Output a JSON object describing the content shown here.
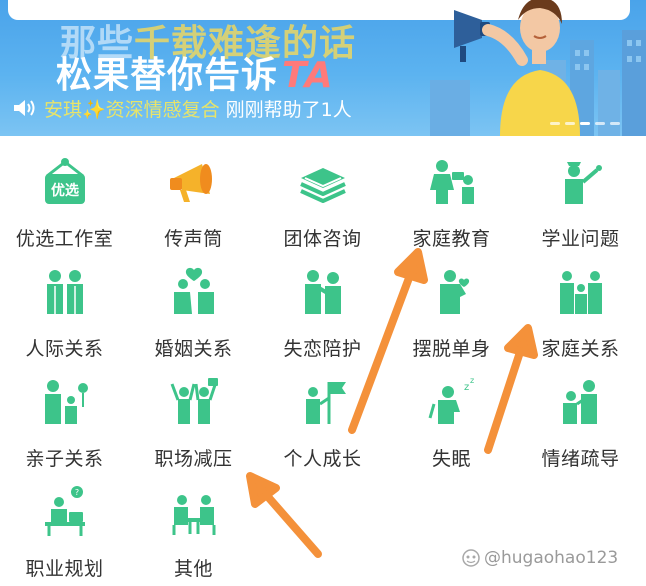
{
  "banner": {
    "headline1_pre": "那些",
    "headline1_hl": "千载难逢的话",
    "headline2": "松果替你告诉",
    "headline2_ta": "TA",
    "ticker_user": "安琪✨资深情感复合",
    "ticker_msg": "刚刚帮助了1人"
  },
  "categories": [
    {
      "label": "优选工作室",
      "icon": "premium-tag-icon",
      "badge": "优选"
    },
    {
      "label": "传声筒",
      "icon": "megaphone-icon"
    },
    {
      "label": "团体咨询",
      "icon": "layers-icon"
    },
    {
      "label": "家庭教育",
      "icon": "family-education-icon"
    },
    {
      "label": "学业问题",
      "icon": "teacher-icon"
    },
    {
      "label": "人际关系",
      "icon": "two-people-icon"
    },
    {
      "label": "婚姻关系",
      "icon": "couple-heart-icon"
    },
    {
      "label": "失恋陪护",
      "icon": "comfort-icon"
    },
    {
      "label": "摆脱单身",
      "icon": "single-person-icon"
    },
    {
      "label": "家庭关系",
      "icon": "family-icon"
    },
    {
      "label": "亲子关系",
      "icon": "parent-child-icon"
    },
    {
      "label": "职场减压",
      "icon": "celebrate-icon"
    },
    {
      "label": "个人成长",
      "icon": "flag-person-icon"
    },
    {
      "label": "失眠",
      "icon": "sleep-icon"
    },
    {
      "label": "情绪疏导",
      "icon": "emotion-icon"
    },
    {
      "label": "职业规划",
      "icon": "career-icon"
    },
    {
      "label": "其他",
      "icon": "group-talk-icon"
    }
  ],
  "colors": {
    "icon_green": "#3dc48a",
    "arrow_orange": "#f4913a",
    "banner_blue": "#4aa3ea"
  },
  "watermark": "@hugaohao123"
}
